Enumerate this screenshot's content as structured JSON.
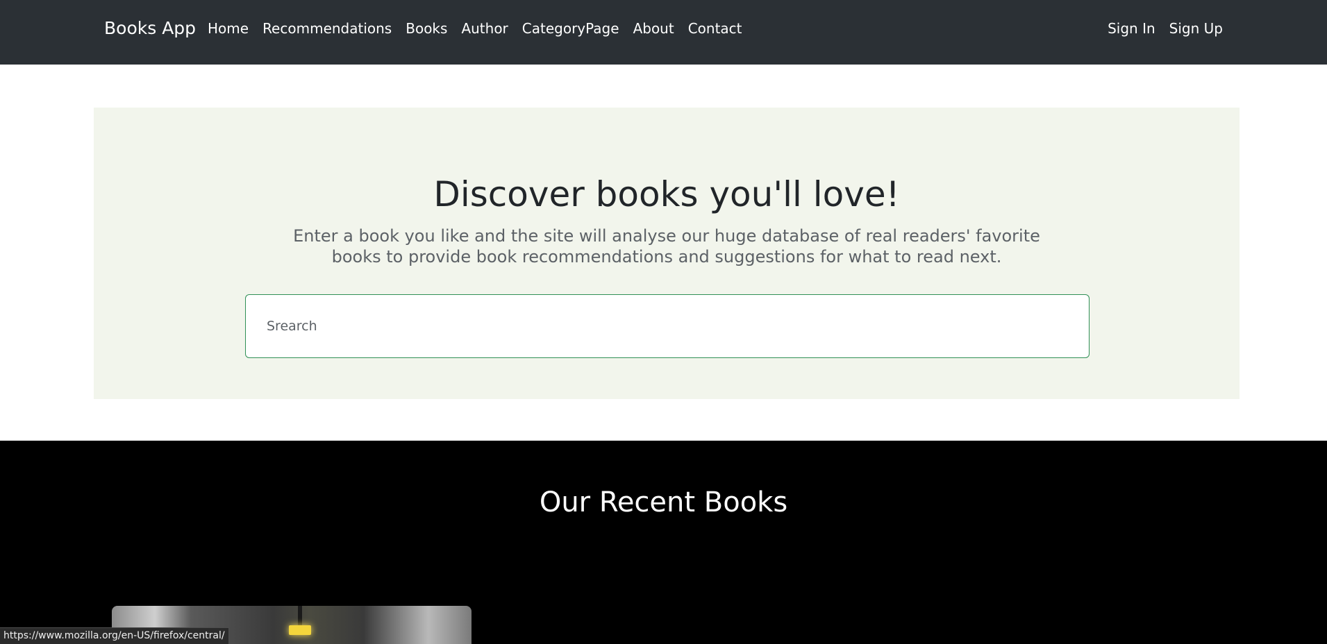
{
  "nav": {
    "brand": "Books App",
    "links": [
      "Home",
      "Recommendations",
      "Books",
      "Author",
      "CategoryPage",
      "About",
      "Contact"
    ],
    "auth": [
      "Sign In",
      "Sign Up"
    ]
  },
  "hero": {
    "title": "Discover books you'll love!",
    "lead": "Enter a book you like and the site will analyse our huge database of real readers' favorite books to provide book recommendations and suggestions for what to read next.",
    "search_placeholder": "Srearch"
  },
  "recent": {
    "title": "Our Recent Books"
  },
  "status_url": "https://www.mozilla.org/en-US/firefox/central/",
  "colors": {
    "navbar": "#2b3035",
    "hero_bg": "#f2f5ec",
    "search_border": "#2f8f55",
    "recent_bg": "#000000"
  }
}
